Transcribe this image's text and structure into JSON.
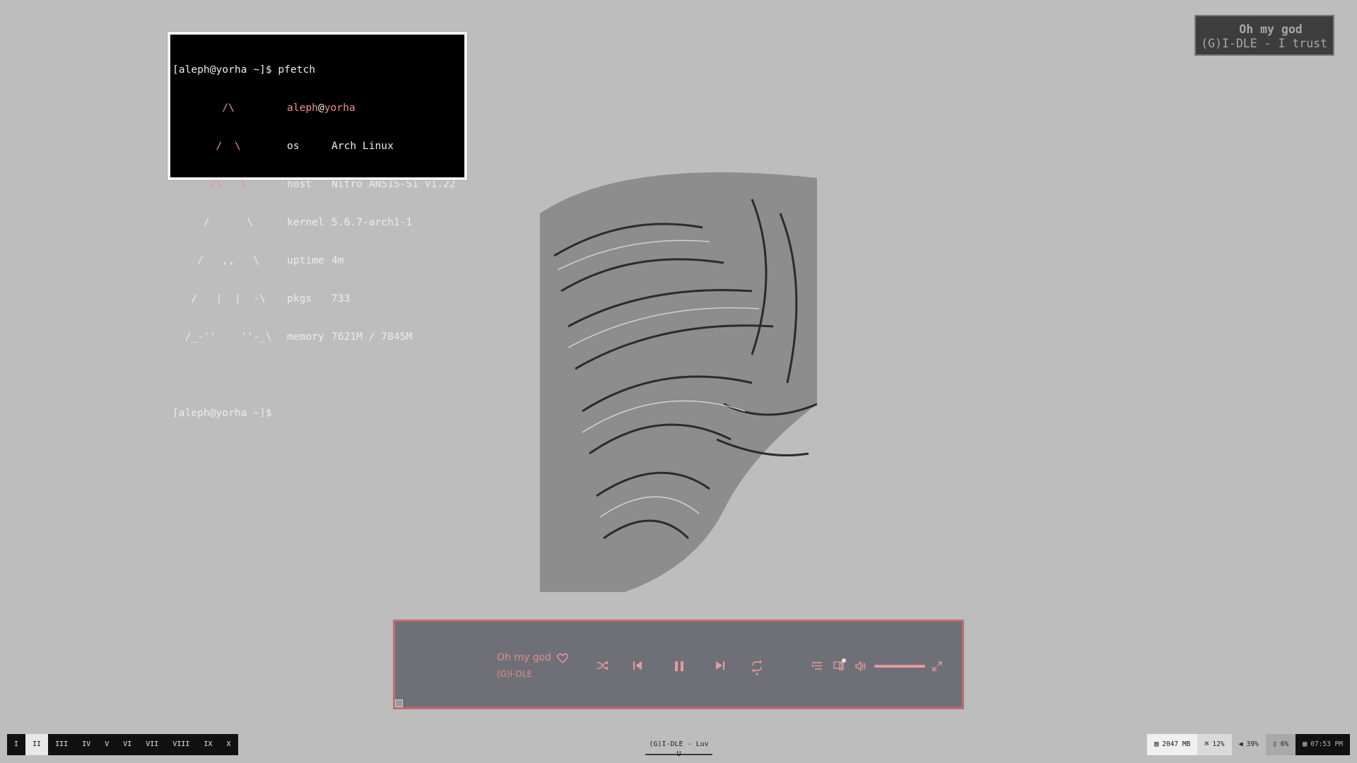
{
  "terminal": {
    "prompt1": "[aleph@yorha ~]$ pfetch",
    "user": "aleph",
    "at": "@",
    "host_name": "yorha",
    "logo": [
      "        /\\",
      "       /  \\",
      "      /\\   \\",
      "     /      \\",
      "    /   ,,   \\",
      "   /   |  |  -\\",
      "  /_-''    ''-_\\"
    ],
    "info": [
      {
        "key": "os",
        "val": "Arch Linux"
      },
      {
        "key": "host",
        "val": "Nitro AN515-51 V1.22"
      },
      {
        "key": "kernel",
        "val": "5.6.7-arch1-1"
      },
      {
        "key": "uptime",
        "val": "4m"
      },
      {
        "key": "pkgs",
        "val": "733"
      },
      {
        "key": "memory",
        "val": "7621M / 7845M"
      }
    ],
    "prompt2": "[aleph@yorha ~]$"
  },
  "notification": {
    "line1": "Oh my god",
    "line2": "(G)I-DLE - I trust"
  },
  "player": {
    "title": "Oh my god",
    "artist": "(G)I-DLE",
    "icons": [
      "heart-icon",
      "shuffle-icon",
      "previous-icon",
      "pause-icon",
      "next-icon",
      "repeat-icon",
      "queue-icon",
      "devices-icon",
      "volume-icon",
      "fullscreen-icon"
    ],
    "volume": 1.0,
    "accent": "#e79aa0",
    "border": "#c26b70",
    "background": "#6f7077"
  },
  "bar": {
    "workspaces": [
      "I",
      "II",
      "III",
      "IV",
      "V",
      "VI",
      "VII",
      "VIII",
      "IX",
      "X"
    ],
    "active_workspace": 1,
    "window_title": "(G)I-DLE - Luv U",
    "memory": "2047 MB",
    "cpu": "12%",
    "volume": "39%",
    "battery": "6%",
    "clock": "07:53 PM"
  },
  "colors": {
    "desktop": "#bdbdbd",
    "terminal_bg": "#000000",
    "terminal_pink": "#ef8d8d"
  }
}
